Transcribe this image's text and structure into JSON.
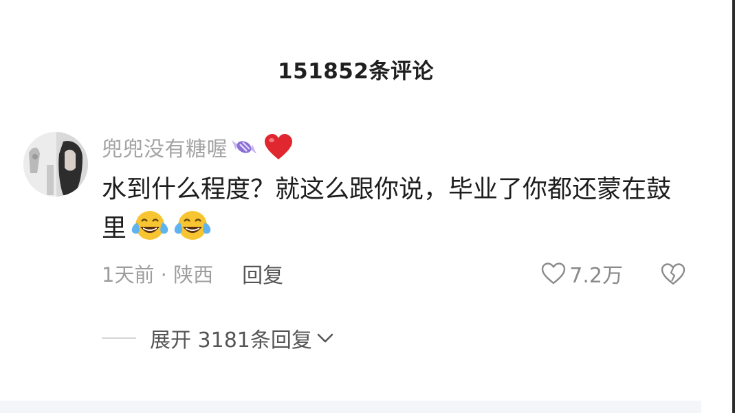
{
  "header": {
    "title": "151852条评论"
  },
  "comment": {
    "username": "兜兜没有糖喔",
    "username_icons": [
      "candy-icon",
      "red-heart-icon"
    ],
    "text": "水到什么程度？就这么跟你说，毕业了你都还蒙在鼓里",
    "text_emojis": [
      "crying-laughing-emoji",
      "crying-laughing-emoji"
    ],
    "time_location": "1天前 · 陕西",
    "reply_label": "回复",
    "like_count": "7.2万"
  },
  "replies": {
    "expand_label": "展开 3181条回复"
  },
  "colors": {
    "username": "#a4a4a4",
    "heart": "#e0262f",
    "meta": "#9d9d9d"
  }
}
